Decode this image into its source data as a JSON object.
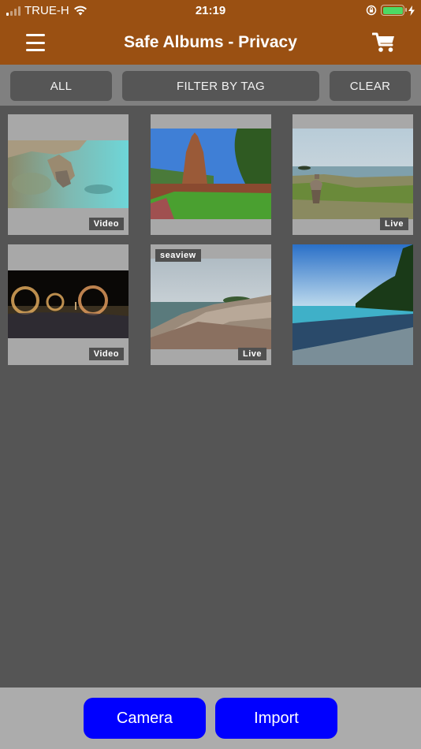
{
  "status_bar": {
    "carrier": "TRUE-H",
    "time": "21:19",
    "signal_bars_on": 1,
    "signal_bars_total": 4,
    "battery_level": 1.0,
    "icons": [
      "signal-icon",
      "wifi-icon",
      "rotation-lock-icon",
      "battery-icon",
      "charging-bolt-icon"
    ]
  },
  "navbar": {
    "title": "Safe Albums - Privacy",
    "left_icon": "hamburger-menu-icon",
    "right_icon": "shopping-cart-icon",
    "color": "#9a5012"
  },
  "filters": {
    "all_label": "ALL",
    "filter_by_tag_label": "FILTER BY TAG",
    "clear_label": "CLEAR"
  },
  "gallery": {
    "items": [
      {
        "scene": "rocky clear turquoise shallow water",
        "type_badge": "Video",
        "tag": null,
        "orientation": "landscape"
      },
      {
        "scene": "ancient brick temple stupa under blue sky",
        "type_badge": null,
        "tag": null,
        "orientation": "landscape"
      },
      {
        "scene": "stacked stone cairn by the sea",
        "type_badge": "Live",
        "tag": null,
        "orientation": "landscape"
      },
      {
        "scene": "fire spinning show on beach at night",
        "type_badge": "Video",
        "tag": null,
        "orientation": "landscape"
      },
      {
        "scene": "layered rocky coast with cloudy sky",
        "type_badge": "Live",
        "tag": "seaview",
        "orientation": "landscape"
      },
      {
        "scene": "tropical beach with trees and blue sky",
        "type_badge": null,
        "tag": null,
        "orientation": "square"
      }
    ]
  },
  "bottom_bar": {
    "camera_label": "Camera",
    "import_label": "Import",
    "button_color": "#0000ff"
  }
}
